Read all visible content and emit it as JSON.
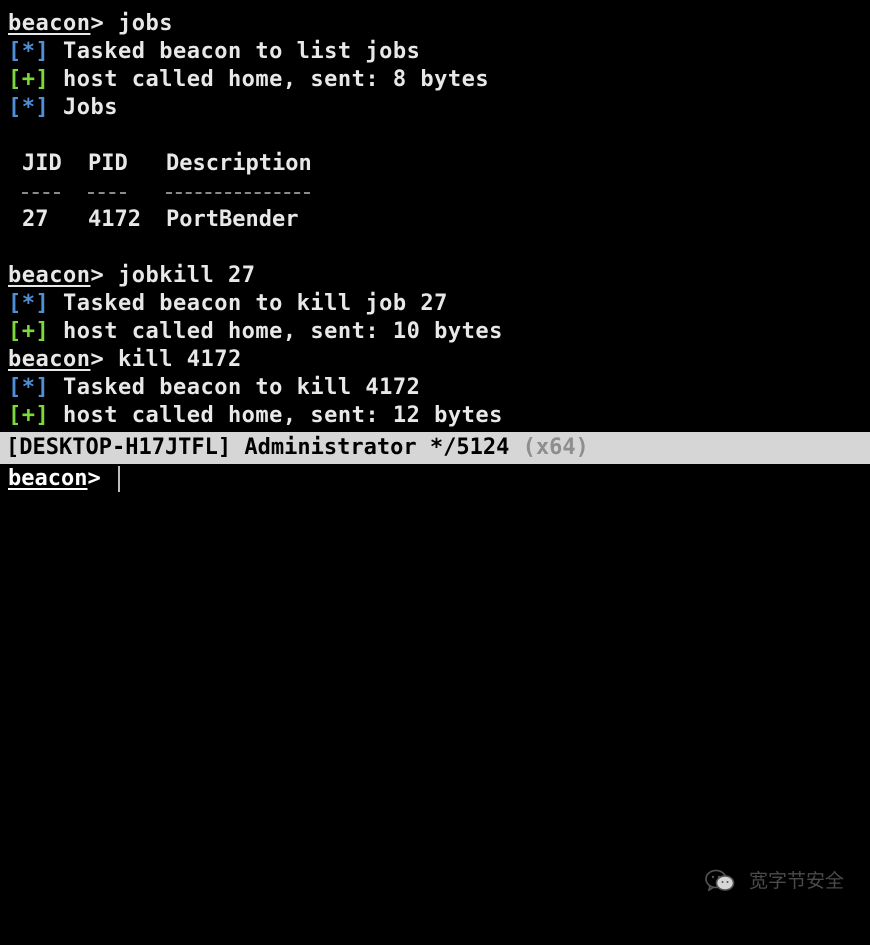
{
  "prompt": "beacon",
  "prompt_suffix": ">",
  "lines": [
    {
      "type": "cmd",
      "text": "jobs"
    },
    {
      "type": "info",
      "tag": "[*]",
      "text": "Tasked beacon to list jobs"
    },
    {
      "type": "ok",
      "tag": "[+]",
      "text": "host called home, sent: 8 bytes"
    },
    {
      "type": "info",
      "tag": "[*]",
      "text": "Jobs"
    }
  ],
  "jobs_table": {
    "headers": [
      "JID",
      "PID",
      "Description"
    ],
    "rows": [
      [
        "27",
        "4172",
        "PortBender"
      ]
    ]
  },
  "lines2": [
    {
      "type": "cmd",
      "text": "jobkill 27"
    },
    {
      "type": "info",
      "tag": "[*]",
      "text": "Tasked beacon to kill job 27"
    },
    {
      "type": "ok",
      "tag": "[+]",
      "text": "host called home, sent: 10 bytes"
    },
    {
      "type": "cmd",
      "text": "kill 4172"
    },
    {
      "type": "info",
      "tag": "[*]",
      "text": "Tasked beacon to kill 4172"
    },
    {
      "type": "ok",
      "tag": "[+]",
      "text": "host called home, sent: 12 bytes"
    }
  ],
  "status": {
    "host": "[DESKTOP-H17JTFL]",
    "user": "Administrator */5124",
    "arch": "(x64)"
  },
  "watermark": {
    "text": "宽字节安全",
    "icon": "wechat-icon"
  },
  "input": {
    "value": "",
    "placeholder": ""
  },
  "colors": {
    "info": "#4f8fd6",
    "ok": "#7bd93a",
    "status_bg": "#d6d6d6"
  }
}
